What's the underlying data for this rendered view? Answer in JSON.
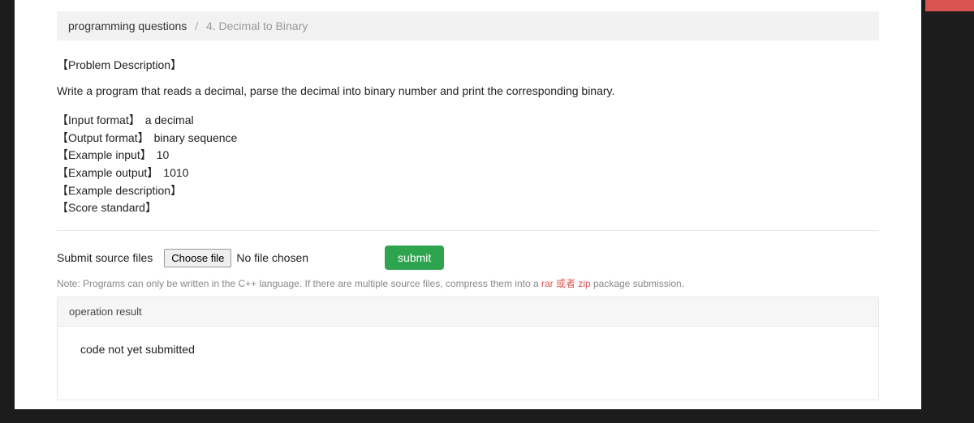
{
  "breadcrumb": {
    "root": "programming questions",
    "sep": "/",
    "current": "4. Decimal to Binary"
  },
  "problem": {
    "descLabel": "【Problem Description】",
    "descText": "Write a program that reads a decimal, parse the decimal into binary number and print the corresponding binary.",
    "inputFormatLabel": "【Input format】",
    "inputFormatValue": "a decimal",
    "outputFormatLabel": "【Output format】",
    "outputFormatValue": "binary sequence",
    "exampleInputLabel": "【Example input】",
    "exampleInputValue": "10",
    "exampleOutputLabel": "【Example output】",
    "exampleOutputValue": "1010",
    "exampleDescLabel": "【Example description】",
    "scoreStdLabel": "【Score standard】"
  },
  "submit": {
    "label": "Submit source files",
    "chooseLabel": "Choose file",
    "fileStatus": "No file chosen",
    "submitLabel": "submit",
    "notePrefix": "Note: Programs can only be written in the C++ language. If there are multiple source files, compress them into a ",
    "rar": "rar",
    "or": " 或者 ",
    "zip": "zip",
    "noteSuffix": " package submission."
  },
  "result": {
    "header": "operation result",
    "body": "code not yet submitted"
  }
}
